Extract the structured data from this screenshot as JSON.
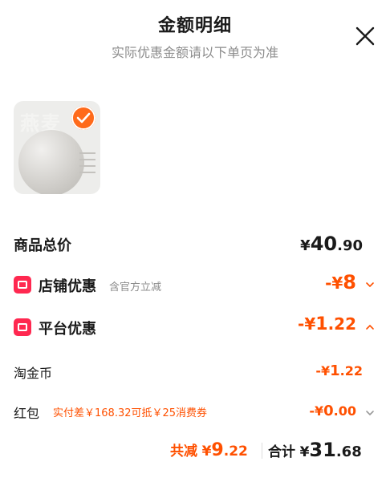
{
  "header": {
    "title": "金额明细",
    "subtitle": "实际优惠金额请以下单页为准",
    "close_icon": "close-icon"
  },
  "product": {
    "image_text": "燕麦",
    "selected_icon": "check-icon",
    "colors": {
      "accent": "#ff6a1a"
    }
  },
  "total": {
    "label": "商品总价",
    "currency": "¥",
    "int": "40",
    "dec": ".90"
  },
  "shop_discount": {
    "label": "店铺优惠",
    "note": "含官方立减",
    "amount_prefix": "-¥",
    "amount": "8",
    "icon": "shop-badge-icon",
    "chevron": "chevron-down-icon"
  },
  "platform_discount": {
    "label": "平台优惠",
    "amount_prefix": "-¥",
    "amount_int": "1",
    "amount_dec": ".22",
    "icon": "platform-badge-icon",
    "chevron": "chevron-up-icon"
  },
  "taojinbi": {
    "label": "淘金币",
    "amount_prefix": "-¥",
    "amount_int": "1",
    "amount_dec": ".22"
  },
  "hongbao": {
    "label": "红包",
    "note": "实付差￥168.32可抵￥25消费券",
    "amount_prefix": "-¥",
    "amount_int": "0",
    "amount_dec": ".00",
    "chevron": "chevron-down-icon"
  },
  "summary": {
    "saved_label": "共减",
    "saved_currency": "¥",
    "saved_int": "9",
    "saved_dec": ".22",
    "total_label": "合计",
    "total_currency": "¥",
    "total_int": "31",
    "total_dec": ".68"
  },
  "colors": {
    "orange": "#ff5000",
    "badge_red": "#ff2850",
    "gray": "#8c8c8c"
  }
}
